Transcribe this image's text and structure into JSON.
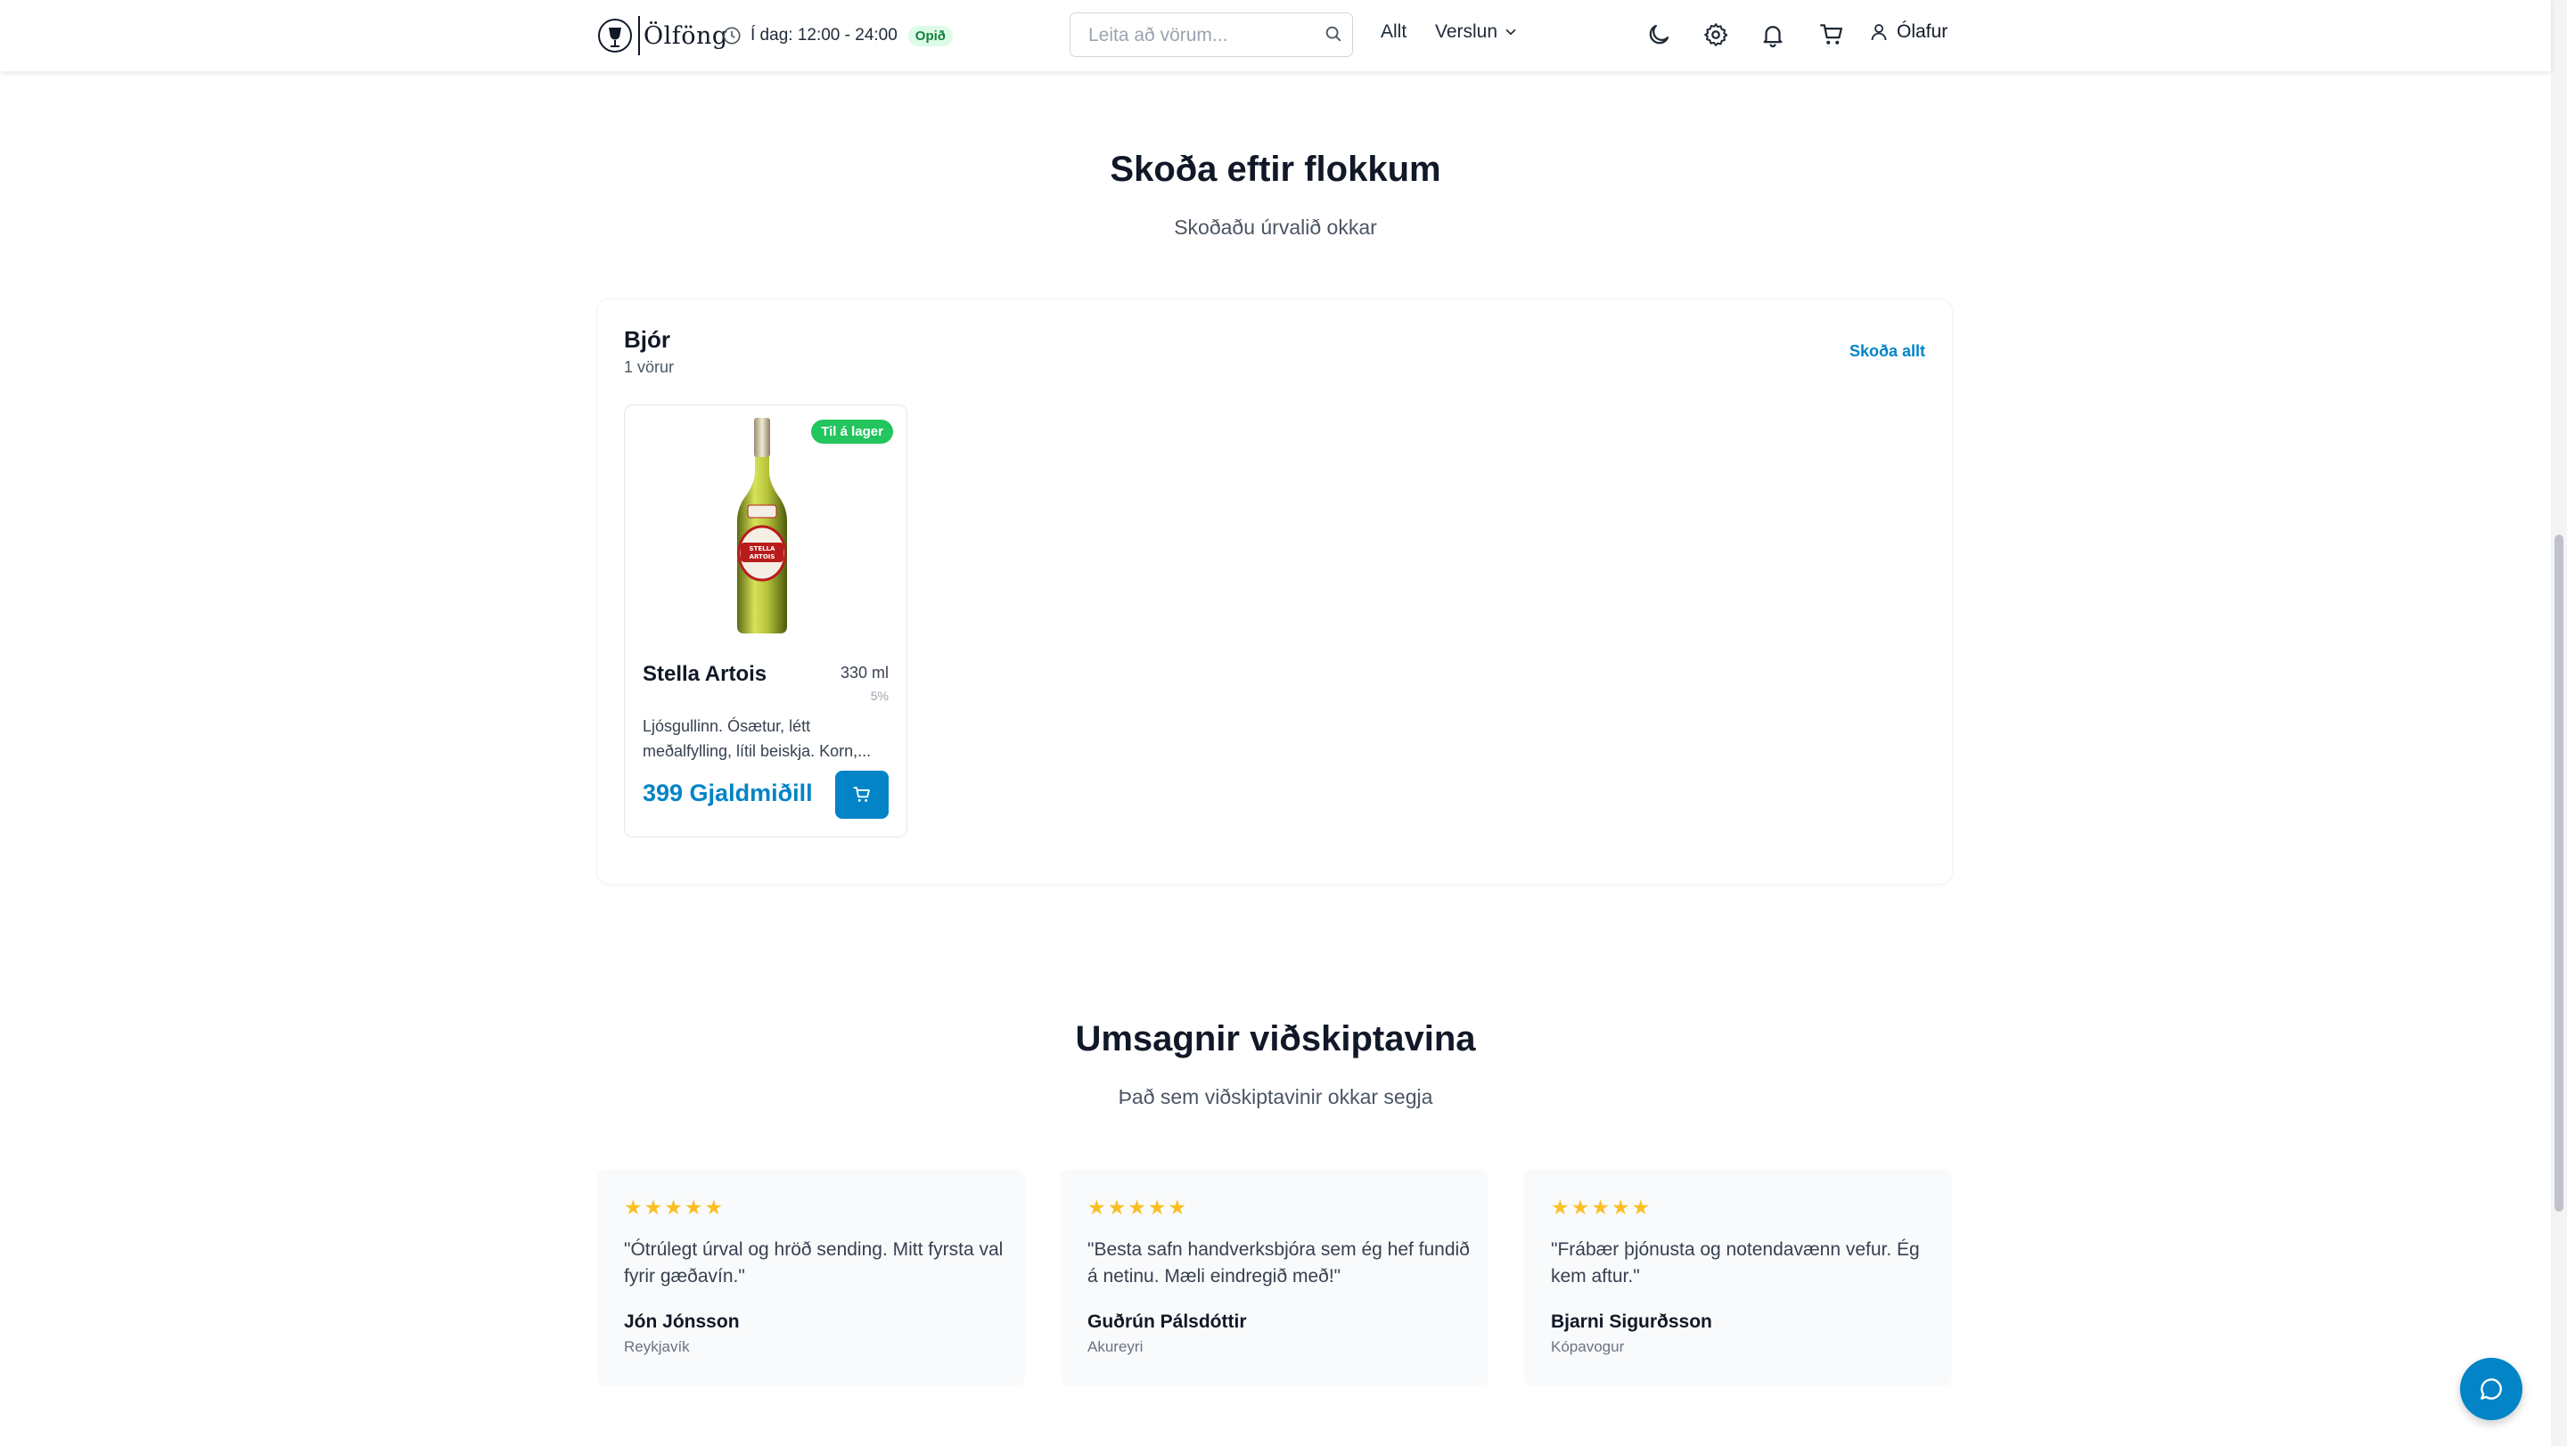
{
  "header": {
    "brand": "Ölföng",
    "hours_label": "Í dag: 12:00 - 24:00",
    "open_badge": "Opið",
    "search_placeholder": "Leita að vörum...",
    "nav_all": "Allt",
    "nav_store": "Verslun",
    "user_name": "Ólafur",
    "icons": [
      "moon-icon",
      "gear-icon",
      "bell-icon",
      "cart-icon",
      "user-icon"
    ]
  },
  "categories_section": {
    "title": "Skoða eftir flokkum",
    "subtitle": "Skoðaðu úrvalið okkar",
    "category": {
      "name": "Bjór",
      "count": "1 vörur",
      "view_all": "Skoða allt",
      "products": [
        {
          "name": "Stella Artois",
          "volume": "330 ml",
          "abv": "5%",
          "stock": "Til á lager",
          "description": "Ljósgullinn. Ósætur, létt meðalfylling, lítil beiskja. Korn,...",
          "price": "399 Gjaldmiðill"
        }
      ]
    }
  },
  "reviews_section": {
    "title": "Umsagnir viðskiptavina",
    "subtitle": "Það sem viðskiptavinir okkar segja",
    "reviews": [
      {
        "stars": "★★★★★",
        "quote": "\"Ótrúlegt úrval og hröð sending. Mitt fyrsta val fyrir gæðavín.\"",
        "name": "Jón Jónsson",
        "city": "Reykjavík"
      },
      {
        "stars": "★★★★★",
        "quote": "\"Besta safn handverksbjóra sem ég hef fundið á netinu. Mæli eindregið með!\"",
        "name": "Guðrún Pálsdóttir",
        "city": "Akureyri"
      },
      {
        "stars": "★★★★★",
        "quote": "\"Frábær þjónusta og notendavænn vefur. Ég kem aftur.\"",
        "name": "Bjarni Sigurðsson",
        "city": "Kópavogur"
      }
    ]
  },
  "colors": {
    "accent": "#0284c7",
    "in_stock": "#22c55e",
    "open_badge_bg": "#dcfce7",
    "open_badge_text": "#15803d",
    "star": "#fbbf24"
  }
}
